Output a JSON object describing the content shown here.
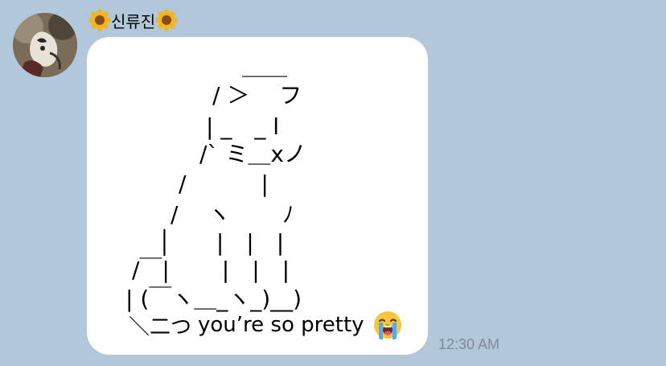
{
  "message": {
    "sender_name": "신류진",
    "sender_prefix_icon": "sunflower-icon",
    "sender_suffix_icon": "sunflower-icon",
    "art_lines": [
      "＿＿",
      "/ ＞　 フ",
      "|  _　_ l",
      "/` ミ＿xノ",
      "/　　　 |",
      "/　 ヽ　　 ﾉ",
      "│　　|　|　|",
      "/￣|　　 |　|　|",
      "| (￣ヽ＿_ヽ_)__)",
      "＼二つ"
    ],
    "caption_text": "you’re so pretty",
    "caption_emoji": "loudly-crying-face-icon",
    "time": "12:30 AM"
  }
}
